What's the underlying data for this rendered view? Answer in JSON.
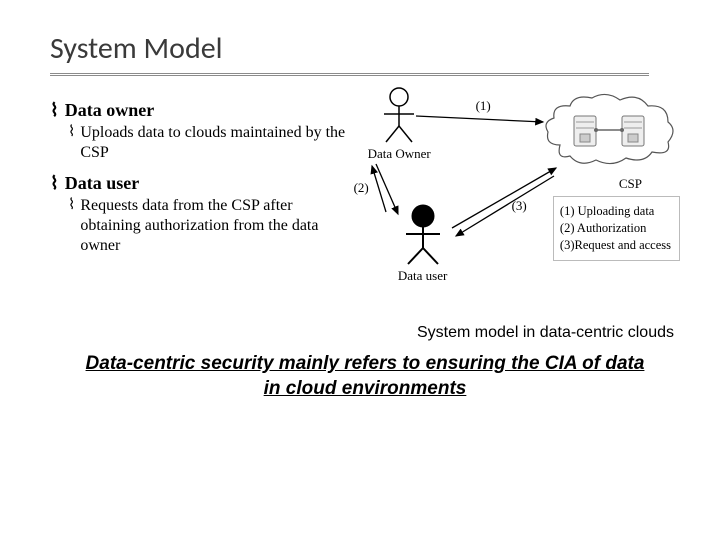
{
  "slide": {
    "title": "System Model",
    "bullets": {
      "owner": {
        "heading": "Data owner",
        "sub": "Uploads data to clouds maintained by the CSP"
      },
      "user": {
        "heading": "Data user",
        "sub": "Requests data from the CSP after obtaining authorization from the data owner"
      }
    },
    "caption": "System model in data-centric clouds",
    "highlight": "Data-centric security mainly refers to ensuring the CIA of data in cloud environments"
  },
  "diagram": {
    "owner_label": "Data Owner",
    "user_label": "Data user",
    "csp_label": "CSP",
    "arrow1": "(1)",
    "arrow2": "(2)",
    "arrow3": "(3)",
    "legend": {
      "l1": "(1) Uploading data",
      "l2": "(2) Authorization",
      "l3": "(3)Request and access"
    }
  }
}
